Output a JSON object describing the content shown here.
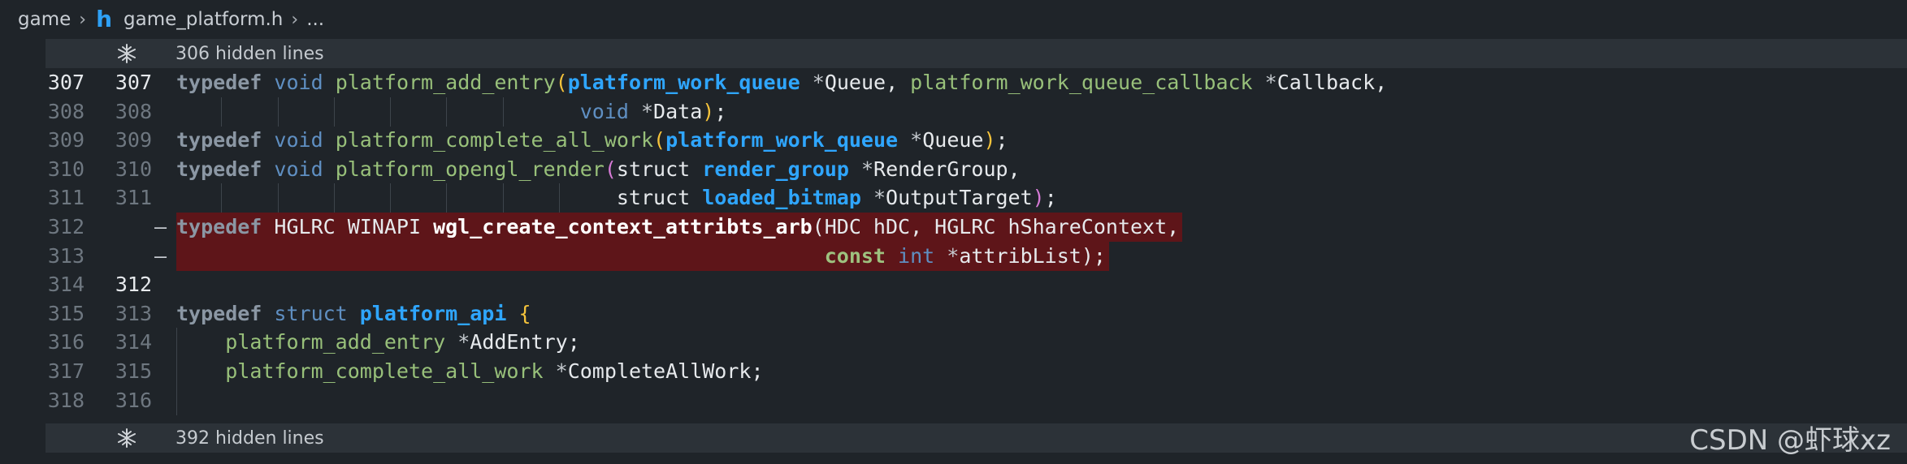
{
  "breadcrumb": {
    "folder": "game",
    "file_icon_glyph": "h",
    "file": "game_platform.h",
    "more": "..."
  },
  "folds": {
    "top_label": "306 hidden lines",
    "bottom_label": "392 hidden lines"
  },
  "lines": [
    {
      "left": "307",
      "right": "307",
      "bright": true,
      "tokens": [
        [
          "kw",
          "typedef"
        ],
        [
          "pl",
          " "
        ],
        [
          "kw2",
          "void"
        ],
        [
          "pl",
          " "
        ],
        [
          "fn",
          "platform_add_entry"
        ],
        [
          "paren",
          "("
        ],
        [
          "ty",
          "platform_work_queue"
        ],
        [
          "pl",
          " "
        ],
        [
          "star",
          "*"
        ],
        [
          "pl",
          "Queue, "
        ],
        [
          "fn",
          "platform_work_queue_callback"
        ],
        [
          "pl",
          " "
        ],
        [
          "star",
          "*"
        ],
        [
          "pl",
          "Callback,"
        ]
      ]
    },
    {
      "left": "308",
      "right": "308",
      "bright": false,
      "tokens": [
        [
          "pl",
          "                                 "
        ],
        [
          "kw2",
          "void"
        ],
        [
          "pl",
          " "
        ],
        [
          "star",
          "*"
        ],
        [
          "pl",
          "Data"
        ],
        [
          "paren",
          ")"
        ],
        [
          "pl",
          ";"
        ]
      ]
    },
    {
      "left": "309",
      "right": "309",
      "bright": false,
      "tokens": [
        [
          "kw",
          "typedef"
        ],
        [
          "pl",
          " "
        ],
        [
          "kw2",
          "void"
        ],
        [
          "pl",
          " "
        ],
        [
          "fn",
          "platform_complete_all_work"
        ],
        [
          "paren",
          "("
        ],
        [
          "ty",
          "platform_work_queue"
        ],
        [
          "pl",
          " "
        ],
        [
          "star",
          "*"
        ],
        [
          "pl",
          "Queue"
        ],
        [
          "paren",
          ")"
        ],
        [
          "pl",
          ";"
        ]
      ]
    },
    {
      "left": "310",
      "right": "310",
      "bright": false,
      "tokens": [
        [
          "kw",
          "typedef"
        ],
        [
          "pl",
          " "
        ],
        [
          "kw2",
          "void"
        ],
        [
          "pl",
          " "
        ],
        [
          "fn",
          "platform_opengl_render"
        ],
        [
          "paren2",
          "("
        ],
        [
          "pl",
          "struct "
        ],
        [
          "ty",
          "render_group"
        ],
        [
          "pl",
          " "
        ],
        [
          "star",
          "*"
        ],
        [
          "pl",
          "RenderGroup,"
        ]
      ]
    },
    {
      "left": "311",
      "right": "311",
      "bright": false,
      "tokens": [
        [
          "pl",
          "                                    struct "
        ],
        [
          "ty",
          "loaded_bitmap"
        ],
        [
          "pl",
          " "
        ],
        [
          "star",
          "*"
        ],
        [
          "pl",
          "OutputTarget"
        ],
        [
          "paren2",
          ")"
        ],
        [
          "pl",
          ";"
        ]
      ]
    },
    {
      "left": "312",
      "right": "",
      "removed": true,
      "bright": false,
      "tokens": [
        [
          "kw",
          "typedef"
        ],
        [
          "pl",
          " HGLRC WINAPI "
        ],
        [
          "wgl",
          "wgl_create_context_attribts_arb"
        ],
        [
          "pl",
          "(HDC hDC, HGLRC hShareContext,"
        ]
      ]
    },
    {
      "left": "313",
      "right": "",
      "removed": true,
      "bright": false,
      "tokens": [
        [
          "pl",
          "                                                     "
        ],
        [
          "const",
          "const"
        ],
        [
          "pl",
          " "
        ],
        [
          "intk",
          "int"
        ],
        [
          "pl",
          " "
        ],
        [
          "star",
          "*"
        ],
        [
          "pl",
          "attribList);"
        ]
      ]
    },
    {
      "left": "314",
      "right": "312",
      "bright": true,
      "right_only_bright": true,
      "tokens": []
    },
    {
      "left": "315",
      "right": "313",
      "bright": false,
      "tokens": [
        [
          "kw",
          "typedef"
        ],
        [
          "pl",
          " "
        ],
        [
          "kw2",
          "struct"
        ],
        [
          "pl",
          " "
        ],
        [
          "ty",
          "platform_api"
        ],
        [
          "pl",
          " "
        ],
        [
          "paren",
          "{"
        ]
      ]
    },
    {
      "left": "316",
      "right": "314",
      "bright": false,
      "tokens": [
        [
          "pl",
          "    "
        ],
        [
          "fn",
          "platform_add_entry"
        ],
        [
          "pl",
          " "
        ],
        [
          "star",
          "*"
        ],
        [
          "pl",
          "AddEntry;"
        ]
      ]
    },
    {
      "left": "317",
      "right": "315",
      "bright": false,
      "tokens": [
        [
          "pl",
          "    "
        ],
        [
          "fn",
          "platform_complete_all_work"
        ],
        [
          "pl",
          " "
        ],
        [
          "star",
          "*"
        ],
        [
          "pl",
          "CompleteAllWork;"
        ]
      ]
    },
    {
      "left": "318",
      "right": "316",
      "bright": false,
      "tokens": []
    }
  ],
  "removed_marker": "—",
  "watermark": "CSDN @虾球xz",
  "colors": {
    "background": "#1f2429",
    "fold_bar": "#2c3238",
    "removed_bg": "#5e1519",
    "type_blue": "#2fa6ff",
    "func_green": "#98c07a"
  },
  "icons": {
    "unfold": "unfold-icon",
    "file": "c-header-file-icon",
    "chevron": "chevron-right-icon"
  }
}
